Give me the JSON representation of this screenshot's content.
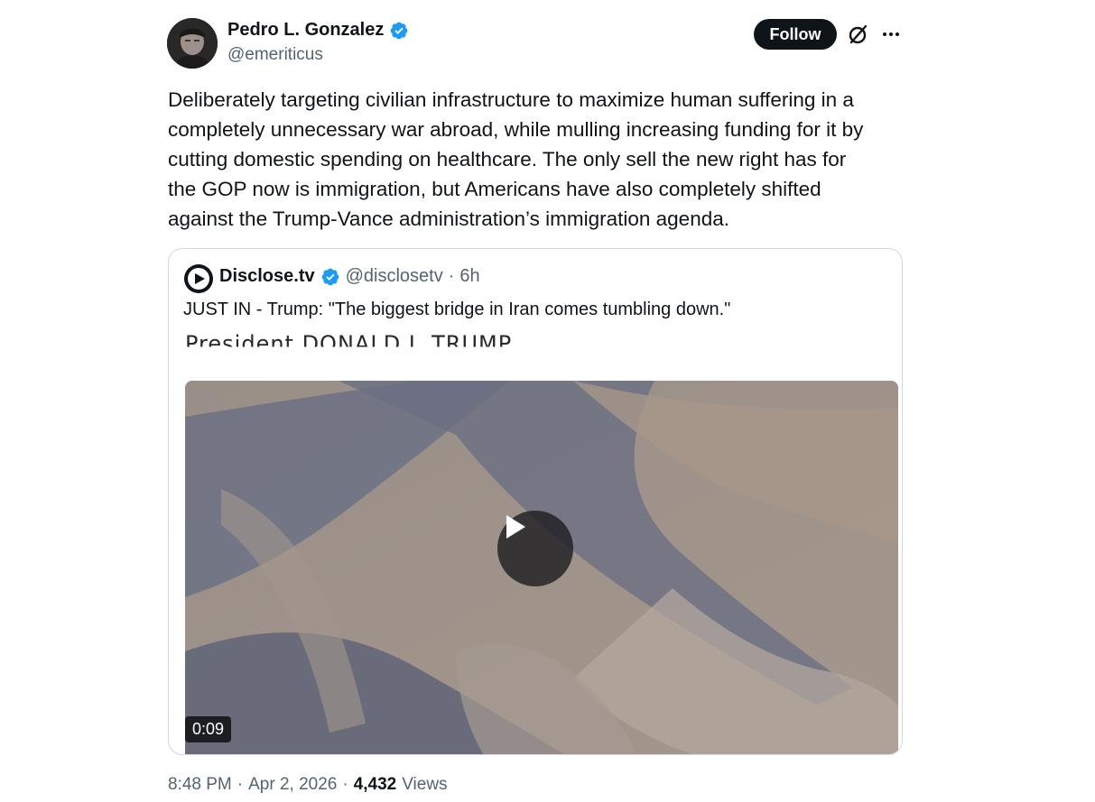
{
  "author": {
    "name": "Pedro L. Gonzalez",
    "handle": "@emeriticus",
    "avatar_icon": "profile-photo"
  },
  "actions": {
    "follow_label": "Follow",
    "grok_icon": "grok-icon",
    "more_icon": "more-icon"
  },
  "post": {
    "text": "Deliberately targeting civilian infrastructure to maximize human suffering in a\ncompletely unnecessary war abroad, while mulling increasing funding for it by\ncutting domestic spending on healthcare. The only sell the new right has for\nthe GOP now is immigration, but Americans have also completely shifted\nagainst the Trump-Vance administration’s immigration agenda."
  },
  "quote": {
    "name": "Disclose.tv",
    "handle": "@disclosetv",
    "separator": "·",
    "age": "6h",
    "text": "JUST IN - Trump: \"The biggest bridge in Iran comes tumbling down.\"",
    "overlay_caption": "President DONALD J. TRUMP",
    "video_duration": "0:09"
  },
  "footer": {
    "time": "8:48 PM",
    "dot1": "·",
    "date": "Apr 2, 2026",
    "dot2": "·",
    "views_count": "4,432",
    "views_label": "Views"
  },
  "colors": {
    "text_primary": "#0f1419",
    "text_secondary": "#536471",
    "verified_blue": "#1d9bf0",
    "border": "#cfd9de"
  }
}
